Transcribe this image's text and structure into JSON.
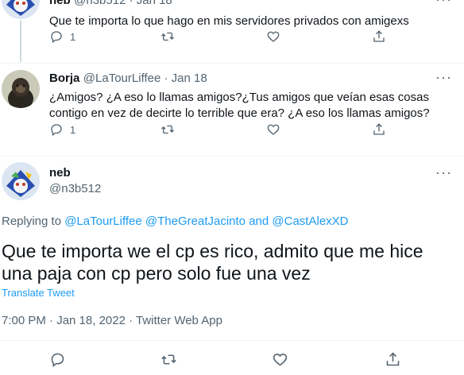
{
  "tweet1": {
    "name": "neb",
    "meta": "@n3b512 · Jan 18",
    "text": "Que te importa lo que hago en mis servidores privados con amigexs",
    "reply_count": "1"
  },
  "tweet2": {
    "name": "Borja",
    "meta": "@LaTourLiffee · Jan 18",
    "text": "¿Amigos? ¿A eso lo llamas amigos?¿Tus amigos que veían esas cosas contigo en vez de decirte lo terrible que era? ¿A eso los llamas amigos?",
    "reply_count": "1"
  },
  "main": {
    "name": "neb",
    "handle": "@n3b512",
    "replying_prefix": "Replying to",
    "reply_handle_1": "@LaTourLiffee",
    "reply_handle_2": "@TheGreatJacinto",
    "reply_and": "and",
    "reply_handle_3": "@CastAlexXD",
    "text": "Que te importa we el cp es rico, admito que me hice una paja con cp pero solo fue una vez",
    "translate": "Translate Tweet",
    "timestamp": "7:00 PM · Jan 18, 2022 · Twitter Web App"
  },
  "more_glyph": "···",
  "icons": [
    "reply-icon",
    "retweet-icon",
    "like-icon",
    "share-icon",
    "more-icon"
  ],
  "colors": {
    "link": "#1d9bf0",
    "muted": "#536471",
    "text": "#0f1419"
  }
}
